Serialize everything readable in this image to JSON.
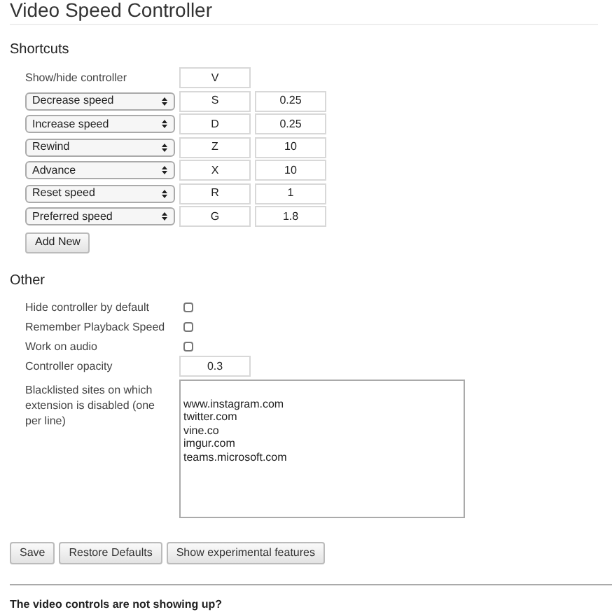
{
  "title": "Video Speed Controller",
  "shortcuts": {
    "heading": "Shortcuts",
    "fixed": {
      "label": "Show/hide controller",
      "key": "V"
    },
    "rows": [
      {
        "action": "Decrease speed",
        "key": "S",
        "value": "0.25"
      },
      {
        "action": "Increase speed",
        "key": "D",
        "value": "0.25"
      },
      {
        "action": "Rewind",
        "key": "Z",
        "value": "10"
      },
      {
        "action": "Advance",
        "key": "X",
        "value": "10"
      },
      {
        "action": "Reset speed",
        "key": "R",
        "value": "1"
      },
      {
        "action": "Preferred speed",
        "key": "G",
        "value": "1.8"
      }
    ],
    "add_button": "Add New"
  },
  "other": {
    "heading": "Other",
    "options": [
      {
        "label": "Hide controller by default",
        "checked": false
      },
      {
        "label": "Remember Playback Speed",
        "checked": false
      },
      {
        "label": "Work on audio",
        "checked": false
      }
    ],
    "opacity": {
      "label": "Controller opacity",
      "value": "0.3"
    },
    "blacklist": {
      "label": "Blacklisted sites on which extension is disabled (one per line)",
      "sites": [
        "www.instagram.com",
        "twitter.com",
        "vine.co",
        "imgur.com",
        "teams.microsoft.com"
      ]
    }
  },
  "buttons": [
    "Save",
    "Restore Defaults",
    "Show experimental features"
  ],
  "help_heading": "The video controls are not showing up?"
}
